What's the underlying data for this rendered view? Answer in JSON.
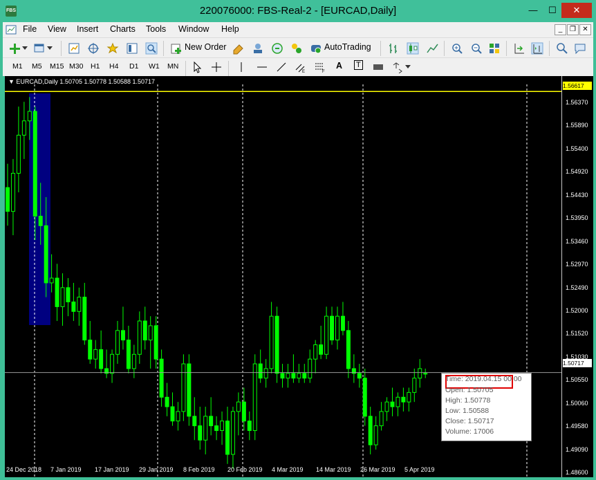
{
  "window": {
    "title": "220076000: FBS-Real-2 - [EURCAD,Daily]",
    "logo_text": "FBS",
    "minimize": "—",
    "maximize": "☐",
    "close": "✕"
  },
  "menu": {
    "items": [
      "File",
      "View",
      "Insert",
      "Charts",
      "Tools",
      "Window",
      "Help"
    ],
    "mdi_min": "_",
    "mdi_restore": "❐",
    "mdi_close": "✕"
  },
  "toolbar": {
    "new_order_label": "New Order",
    "autotrading_label": "AutoTrading"
  },
  "timeframes": [
    "M1",
    "M5",
    "M15",
    "M30",
    "H1",
    "H4",
    "D1",
    "W1",
    "MN"
  ],
  "drawing_tools": {
    "text_tool": "A",
    "label_tool": "T"
  },
  "chart": {
    "header_text": "EURCAD,Daily  1.50705 1.50778 1.50588 1.50717",
    "top_price_label": "1.56617",
    "current_price_label": "1.50717",
    "colors": {
      "background": "#000000",
      "candles": "#00ff00",
      "bid_line": "#ffff00",
      "highlight": "#000080"
    }
  },
  "chart_data": {
    "type": "candlestick",
    "symbol": "EURCAD",
    "timeframe": "Daily",
    "y_ticks": [
      "1.56370",
      "1.55890",
      "1.55400",
      "1.54920",
      "1.54430",
      "1.53950",
      "1.53460",
      "1.52970",
      "1.52490",
      "1.52000",
      "1.51520",
      "1.51030",
      "1.50550",
      "1.50060",
      "1.49580",
      "1.49090",
      "1.48600"
    ],
    "x_ticks": [
      "24 Dec 2018",
      "7 Jan 2019",
      "17 Jan 2019",
      "29 Jan 2019",
      "8 Feb 2019",
      "20 Feb 2019",
      "4 Mar 2019",
      "14 Mar 2019",
      "26 Mar 2019",
      "5 Apr 2019"
    ],
    "ylim": [
      1.4852,
      1.5694
    ],
    "candles": [
      [
        1.546,
        1.551,
        1.538,
        1.541
      ],
      [
        1.541,
        1.552,
        1.536,
        1.549
      ],
      [
        1.549,
        1.563,
        1.545,
        1.557
      ],
      [
        1.557,
        1.564,
        1.552,
        1.56
      ],
      [
        1.56,
        1.565,
        1.556,
        1.562
      ],
      [
        1.562,
        1.563,
        1.535,
        1.54
      ],
      [
        1.54,
        1.547,
        1.534,
        1.538
      ],
      [
        1.538,
        1.544,
        1.523,
        1.526
      ],
      [
        1.526,
        1.532,
        1.524,
        1.527
      ],
      [
        1.527,
        1.53,
        1.518,
        1.521
      ],
      [
        1.521,
        1.528,
        1.517,
        1.525
      ],
      [
        1.525,
        1.527,
        1.519,
        1.522
      ],
      [
        1.522,
        1.526,
        1.518,
        1.52
      ],
      [
        1.52,
        1.525,
        1.517,
        1.523
      ],
      [
        1.523,
        1.526,
        1.513,
        1.514
      ],
      [
        1.514,
        1.518,
        1.509,
        1.51
      ],
      [
        1.51,
        1.514,
        1.508,
        1.512
      ],
      [
        1.512,
        1.516,
        1.507,
        1.508
      ],
      [
        1.508,
        1.512,
        1.506,
        1.507
      ],
      [
        1.507,
        1.512,
        1.505,
        1.511
      ],
      [
        1.511,
        1.518,
        1.509,
        1.516
      ],
      [
        1.516,
        1.521,
        1.512,
        1.514
      ],
      [
        1.514,
        1.517,
        1.507,
        1.508
      ],
      [
        1.508,
        1.513,
        1.506,
        1.511
      ],
      [
        1.511,
        1.52,
        1.509,
        1.518
      ],
      [
        1.518,
        1.521,
        1.512,
        1.514
      ],
      [
        1.514,
        1.519,
        1.508,
        1.517
      ],
      [
        1.517,
        1.519,
        1.508,
        1.51
      ],
      [
        1.51,
        1.512,
        1.5,
        1.502
      ],
      [
        1.502,
        1.505,
        1.498,
        1.5
      ],
      [
        1.5,
        1.503,
        1.496,
        1.497
      ],
      [
        1.497,
        1.501,
        1.495,
        1.499
      ],
      [
        1.499,
        1.511,
        1.497,
        1.509
      ],
      [
        1.509,
        1.511,
        1.496,
        1.498
      ],
      [
        1.498,
        1.502,
        1.493,
        1.496
      ],
      [
        1.496,
        1.5,
        1.491,
        1.493
      ],
      [
        1.493,
        1.5,
        1.49,
        1.498
      ],
      [
        1.498,
        1.502,
        1.494,
        1.496
      ],
      [
        1.496,
        1.498,
        1.493,
        1.495
      ],
      [
        1.495,
        1.499,
        1.492,
        1.497
      ],
      [
        1.497,
        1.5,
        1.488,
        1.49
      ],
      [
        1.49,
        1.5,
        1.487,
        1.499
      ],
      [
        1.499,
        1.503,
        1.494,
        1.501
      ],
      [
        1.501,
        1.504,
        1.495,
        1.497
      ],
      [
        1.497,
        1.499,
        1.493,
        1.495
      ],
      [
        1.495,
        1.511,
        1.493,
        1.509
      ],
      [
        1.509,
        1.512,
        1.505,
        1.506
      ],
      [
        1.506,
        1.51,
        1.504,
        1.508
      ],
      [
        1.508,
        1.522,
        1.507,
        1.519
      ],
      [
        1.519,
        1.521,
        1.505,
        1.507
      ],
      [
        1.507,
        1.509,
        1.504,
        1.506
      ],
      [
        1.506,
        1.509,
        1.504,
        1.507
      ],
      [
        1.507,
        1.511,
        1.505,
        1.506
      ],
      [
        1.506,
        1.509,
        1.505,
        1.507
      ],
      [
        1.507,
        1.509,
        1.505,
        1.506
      ],
      [
        1.506,
        1.512,
        1.505,
        1.51
      ],
      [
        1.51,
        1.514,
        1.507,
        1.513
      ],
      [
        1.513,
        1.517,
        1.51,
        1.511
      ],
      [
        1.511,
        1.521,
        1.51,
        1.519
      ],
      [
        1.519,
        1.521,
        1.513,
        1.514
      ],
      [
        1.514,
        1.521,
        1.512,
        1.519
      ],
      [
        1.519,
        1.522,
        1.515,
        1.516
      ],
      [
        1.516,
        1.518,
        1.506,
        1.508
      ],
      [
        1.508,
        1.511,
        1.505,
        1.507
      ],
      [
        1.507,
        1.509,
        1.504,
        1.506
      ],
      [
        1.506,
        1.508,
        1.496,
        1.498
      ],
      [
        1.498,
        1.5,
        1.49,
        1.492
      ],
      [
        1.492,
        1.498,
        1.491,
        1.496
      ],
      [
        1.496,
        1.501,
        1.495,
        1.499
      ],
      [
        1.499,
        1.502,
        1.497,
        1.501
      ],
      [
        1.501,
        1.504,
        1.498,
        1.5
      ],
      [
        1.5,
        1.503,
        1.498,
        1.502
      ],
      [
        1.502,
        1.504,
        1.499,
        1.501
      ],
      [
        1.501,
        1.504,
        1.499,
        1.503
      ],
      [
        1.503,
        1.508,
        1.501,
        1.506
      ],
      [
        1.506,
        1.51,
        1.504,
        1.508
      ],
      [
        1.507,
        1.508,
        1.506,
        1.507
      ]
    ],
    "tooltip": {
      "time": "Time: 2019.04.15 00:00",
      "open": "Open: 1.50705",
      "high": "High: 1.50778",
      "low": "Low:  1.50588",
      "close": "Close: 1.50717",
      "volume": "Volume: 17006"
    }
  }
}
